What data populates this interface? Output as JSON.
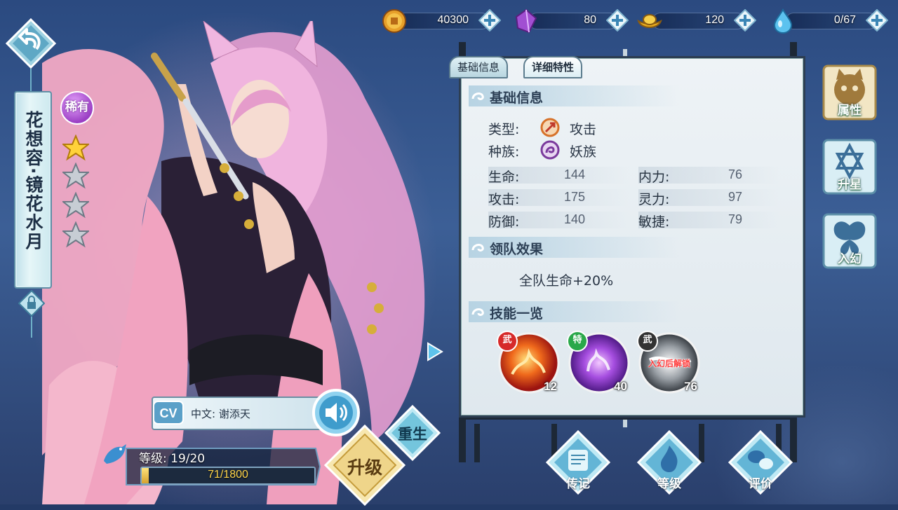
{
  "resources": [
    {
      "icon": "gold-coin-icon",
      "value": "40300"
    },
    {
      "icon": "purple-crystal-icon",
      "value": "80"
    },
    {
      "icon": "gold-ingot-icon",
      "value": "120"
    },
    {
      "icon": "water-drop-icon",
      "value": "0/67"
    }
  ],
  "character": {
    "name": "花想容·镜花水月",
    "rarity": "稀有",
    "stars_filled": 1,
    "stars_total": 4
  },
  "tabs": [
    {
      "label": "基础信息",
      "active": false
    },
    {
      "label": "详细特性",
      "active": true
    }
  ],
  "basic_info": {
    "heading": "基础信息",
    "type_label": "类型:",
    "type_value": "攻击",
    "race_label": "种族:",
    "race_value": "妖族",
    "stats": [
      {
        "label": "生命:",
        "value": "144"
      },
      {
        "label": "内力:",
        "value": "76"
      },
      {
        "label": "攻击:",
        "value": "175"
      },
      {
        "label": "灵力:",
        "value": "97"
      },
      {
        "label": "防御:",
        "value": "140"
      },
      {
        "label": "敏捷:",
        "value": "79"
      }
    ]
  },
  "leader_effect": {
    "heading": "领队效果",
    "text": "全队生命+20%"
  },
  "skills": {
    "heading": "技能一览",
    "items": [
      {
        "badge": "武",
        "level": "12",
        "badge_color": "#d62a2a"
      },
      {
        "badge": "特",
        "level": "40",
        "badge_color": "#2aa84a"
      },
      {
        "badge": "武",
        "level": "76",
        "badge_color": "#333333",
        "lock_text": "入幻后解锁"
      }
    ]
  },
  "side_buttons": [
    {
      "label": "属性",
      "icon": "cat-face-icon",
      "active": true
    },
    {
      "label": "升星",
      "icon": "hexagram-star-icon",
      "active": false
    },
    {
      "label": "入幻",
      "icon": "butterfly-icon",
      "active": false
    }
  ],
  "cv": {
    "badge": "CV",
    "text": "中文: 谢添天"
  },
  "level": {
    "text": "等级: 19/20",
    "xp_text": "71/1800",
    "xp_fraction": 0.04
  },
  "actions": {
    "upgrade": "升级",
    "rebirth": "重生",
    "biography": "传记",
    "grade": "等级",
    "review": "评价"
  }
}
